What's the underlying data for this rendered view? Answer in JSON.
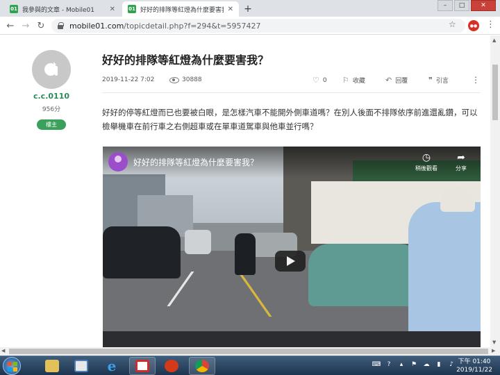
{
  "browser": {
    "tabs": [
      {
        "title": "我參與的文章 - Mobile01",
        "favicon": "01"
      },
      {
        "title": "好好的排隊等紅燈為什麼要害我",
        "favicon": "01"
      }
    ],
    "url_host": "mobile01.com",
    "url_path": "/topicdetail.php?f=294&t=5957427"
  },
  "author": {
    "name": "c.c.0110",
    "points": "956分",
    "badge": "樓主"
  },
  "post": {
    "title": "好好的排隊等紅燈為什麼要害我？",
    "date": "2019-11-22 7:02",
    "views": "30888",
    "likes": "0",
    "bookmark_label": "收藏",
    "reply_label": "回覆",
    "quote_label": "引言",
    "body": "好好的停等紅燈而已也要被白眼，是怎樣汽車不能開外側車道嗎？在別人後面不排隊依序前進還亂鑽，可以檢舉機車在前行車之右側超車或在單車道駕車與他車並行嗎？"
  },
  "video": {
    "title": "好好的排隊等紅燈為什麼要害我？",
    "watch_later_label": "稍後觀看",
    "share_label": "分享"
  },
  "taskbar": {
    "time": "下午 01:40",
    "date": "2019/11/22"
  },
  "colors": {
    "accent_green": "#3aa05c",
    "username_green": "#2a8a5a",
    "taskbar": "#1d3450"
  }
}
